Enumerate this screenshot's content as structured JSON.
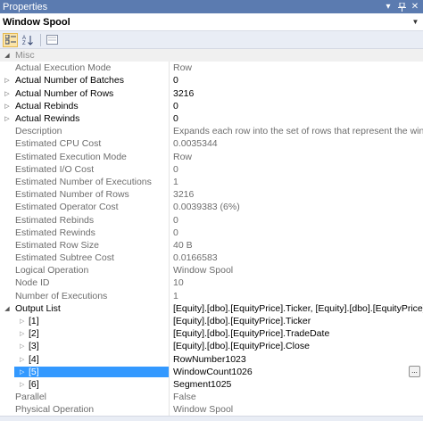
{
  "window": {
    "title": "Properties",
    "pin_icon": "pin-icon",
    "close_icon": "close-icon",
    "menu_icon": "dropdown-icon"
  },
  "object_selector": {
    "value": "Window Spool"
  },
  "toolbar": {
    "buttons": [
      "categorized-icon",
      "alphabetical-icon",
      "property-pages-icon"
    ]
  },
  "category": {
    "label": "Misc"
  },
  "properties": [
    {
      "name": "Actual Execution Mode",
      "value": "Row"
    },
    {
      "name": "Actual Number of Batches",
      "value": "0"
    },
    {
      "name": "Actual Number of Rows",
      "value": "3216"
    },
    {
      "name": "Actual Rebinds",
      "value": "0"
    },
    {
      "name": "Actual Rewinds",
      "value": "0"
    },
    {
      "name": "Description",
      "value": "Expands each row into the set of rows that represent the window associ"
    },
    {
      "name": "Estimated CPU Cost",
      "value": "0.0035344"
    },
    {
      "name": "Estimated Execution Mode",
      "value": "Row"
    },
    {
      "name": "Estimated I/O Cost",
      "value": "0"
    },
    {
      "name": "Estimated Number of Executions",
      "value": "1"
    },
    {
      "name": "Estimated Number of Rows",
      "value": "3216"
    },
    {
      "name": "Estimated Operator Cost",
      "value": "0.0039383 (6%)"
    },
    {
      "name": "Estimated Rebinds",
      "value": "0"
    },
    {
      "name": "Estimated Rewinds",
      "value": "0"
    },
    {
      "name": "Estimated Row Size",
      "value": "40 B"
    },
    {
      "name": "Estimated Subtree Cost",
      "value": "0.0166583"
    },
    {
      "name": "Logical Operation",
      "value": "Window Spool"
    },
    {
      "name": "Node ID",
      "value": "10"
    },
    {
      "name": "Number of Executions",
      "value": "1"
    },
    {
      "name": "Output List",
      "value": "[Equity].[dbo].[EquityPrice].Ticker, [Equity].[dbo].[EquityPrice].TradeDa"
    },
    {
      "name": "[1]",
      "value": "[Equity].[dbo].[EquityPrice].Ticker"
    },
    {
      "name": "[2]",
      "value": "[Equity].[dbo].[EquityPrice].TradeDate"
    },
    {
      "name": "[3]",
      "value": "[Equity].[dbo].[EquityPrice].Close"
    },
    {
      "name": "[4]",
      "value": "RowNumber1023"
    },
    {
      "name": "[5]",
      "value": "WindowCount1026"
    },
    {
      "name": "[6]",
      "value": "Segment1025"
    },
    {
      "name": "Parallel",
      "value": "False"
    },
    {
      "name": "Physical Operation",
      "value": "Window Spool"
    }
  ],
  "ellipsis_button": "...",
  "colors": {
    "titlebar": "#5b7bb0",
    "toolbar": "#e9edf5",
    "selection": "#3399ff",
    "readonly_text": "#6d6d6d"
  }
}
